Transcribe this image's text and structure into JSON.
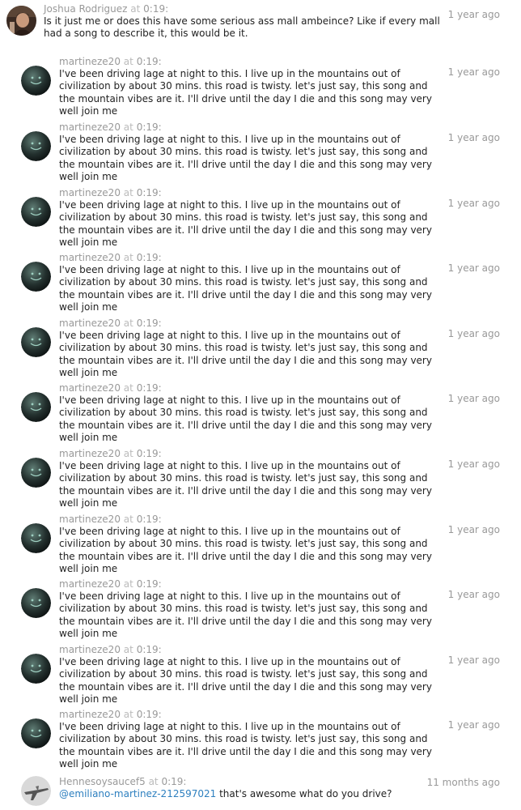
{
  "comments": [
    {
      "user": "Joshua Rodriguez",
      "at": "at",
      "time": "0:19",
      "text": "Is it just me or does this have some serious ass mall ambeince? Like if every mall had a song to describe it, this would be it.",
      "age": "1 year ago",
      "avatar": "portrait"
    },
    {
      "user": "martineze20",
      "at": "at",
      "time": "0:19",
      "text": "I've been driving lage at night to this. I live up in the mountains out of civilization by about 30 mins. this road is twisty. let's just say, this song and the mountain vibes are it. I'll drive until the day I die and this song may very well join me",
      "age": "1 year ago",
      "avatar": "smiley-globe"
    },
    {
      "user": "martineze20",
      "at": "at",
      "time": "0:19",
      "text": "I've been driving lage at night to this. I live up in the mountains out of civilization by about 30 mins. this road is twisty. let's just say, this song and the mountain vibes are it. I'll drive until the day I die and this song may very well join me",
      "age": "1 year ago",
      "avatar": "smiley-globe"
    },
    {
      "user": "martineze20",
      "at": "at",
      "time": "0:19",
      "text": "I've been driving lage at night to this. I live up in the mountains out of civilization by about 30 mins. this road is twisty. let's just say, this song and the mountain vibes are it. I'll drive until the day I die and this song may very well join me",
      "age": "1 year ago",
      "avatar": "smiley-globe"
    },
    {
      "user": "martineze20",
      "at": "at",
      "time": "0:19",
      "text": "I've been driving lage at night to this. I live up in the mountains out of civilization by about 30 mins. this road is twisty. let's just say, this song and the mountain vibes are it. I'll drive until the day I die and this song may very well join me",
      "age": "1 year ago",
      "avatar": "smiley-globe"
    },
    {
      "user": "martineze20",
      "at": "at",
      "time": "0:19",
      "text": "I've been driving lage at night to this. I live up in the mountains out of civilization by about 30 mins. this road is twisty. let's just say, this song and the mountain vibes are it. I'll drive until the day I die and this song may very well join me",
      "age": "1 year ago",
      "avatar": "smiley-globe"
    },
    {
      "user": "martineze20",
      "at": "at",
      "time": "0:19",
      "text": "I've been driving lage at night to this. I live up in the mountains out of civilization by about 30 mins. this road is twisty. let's just say, this song and the mountain vibes are it. I'll drive until the day I die and this song may very well join me",
      "age": "1 year ago",
      "avatar": "smiley-globe"
    },
    {
      "user": "martineze20",
      "at": "at",
      "time": "0:19",
      "text": "I've been driving lage at night to this. I live up in the mountains out of civilization by about 30 mins. this road is twisty. let's just say, this song and the mountain vibes are it. I'll drive until the day I die and this song may very well join me",
      "age": "1 year ago",
      "avatar": "smiley-globe"
    },
    {
      "user": "martineze20",
      "at": "at",
      "time": "0:19",
      "text": "I've been driving lage at night to this. I live up in the mountains out of civilization by about 30 mins. this road is twisty. let's just say, this song and the mountain vibes are it. I'll drive until the day I die and this song may very well join me",
      "age": "1 year ago",
      "avatar": "smiley-globe"
    },
    {
      "user": "martineze20",
      "at": "at",
      "time": "0:19",
      "text": "I've been driving lage at night to this. I live up in the mountains out of civilization by about 30 mins. this road is twisty. let's just say, this song and the mountain vibes are it. I'll drive until the day I die and this song may very well join me",
      "age": "1 year ago",
      "avatar": "smiley-globe"
    },
    {
      "user": "martineze20",
      "at": "at",
      "time": "0:19",
      "text": "I've been driving lage at night to this. I live up in the mountains out of civilization by about 30 mins. this road is twisty. let's just say, this song and the mountain vibes are it. I'll drive until the day I die and this song may very well join me",
      "age": "1 year ago",
      "avatar": "smiley-globe"
    },
    {
      "user": "martineze20",
      "at": "at",
      "time": "0:19",
      "text": "I've been driving lage at night to this. I live up in the mountains out of civilization by about 30 mins. this road is twisty. let's just say, this song and the mountain vibes are it. I'll drive until the day I die and this song may very well join me",
      "age": "1 year ago",
      "avatar": "smiley-globe"
    },
    {
      "user": "Hennesoysaucef5",
      "at": "at",
      "time": "0:19",
      "mention": "@emiliano-martinez-212597021",
      "text": " that's awesome what do you drive?",
      "age": "11 months ago",
      "avatar": "plane"
    }
  ],
  "colors": {
    "meta_gray": "#999999",
    "text": "#222222",
    "link": "#2d7fbf"
  }
}
